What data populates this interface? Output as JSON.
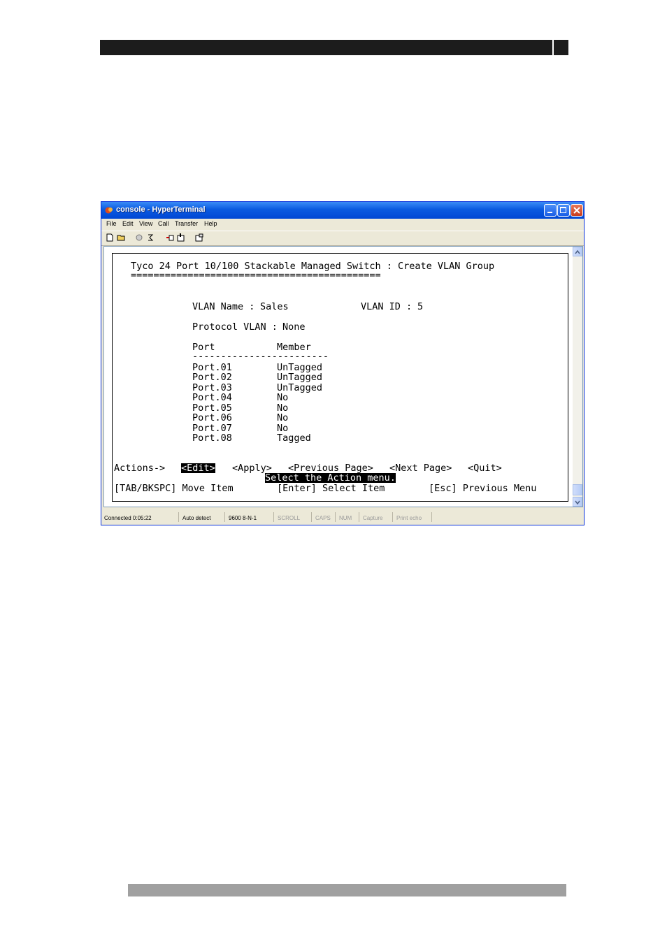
{
  "window": {
    "title": "console - HyperTerminal",
    "colors": {
      "titlebar": "#0a5ae0",
      "close": "#c73d1e"
    }
  },
  "menu": [
    "File",
    "Edit",
    "View",
    "Call",
    "Transfer",
    "Help"
  ],
  "toolbar_icons": [
    "new-icon",
    "open-icon",
    "disconnect-icon",
    "call-icon",
    "send-icon",
    "receive-icon",
    "properties-icon"
  ],
  "terminal": {
    "heading": "Tyco 24 Port 10/100 Stackable Managed Switch : Create VLAN Group",
    "underline": "============================================",
    "vlan_name_label": "VLAN Name :",
    "vlan_name": "Sales",
    "vlan_id_label": "VLAN ID :",
    "vlan_id": "5",
    "protocol_label": "Protocol VLAN :",
    "protocol": "None",
    "col_port": "Port",
    "col_member": "Member",
    "table_rule": "------------------------",
    "rows": [
      {
        "port": "Port.01",
        "member": "UnTagged"
      },
      {
        "port": "Port.02",
        "member": "UnTagged"
      },
      {
        "port": "Port.03",
        "member": "UnTagged"
      },
      {
        "port": "Port.04",
        "member": "No"
      },
      {
        "port": "Port.05",
        "member": "No"
      },
      {
        "port": "Port.06",
        "member": "No"
      },
      {
        "port": "Port.07",
        "member": "No"
      },
      {
        "port": "Port.08",
        "member": "Tagged"
      }
    ],
    "actions_label": "Actions->",
    "actions": {
      "edit": "<Edit>",
      "apply": "<Apply>",
      "prev": "<Previous Page>",
      "next": "<Next Page>",
      "quit": "<Quit>"
    },
    "message": "Select the Action menu.",
    "help_tab": "[TAB/BKSPC] Move Item",
    "help_enter": "[Enter] Select Item",
    "help_esc": "[Esc] Previous Menu"
  },
  "status": {
    "connected": "Connected 0:05:22",
    "detect": "Auto detect",
    "settings": "9600 8-N-1",
    "scroll": "SCROLL",
    "caps": "CAPS",
    "num": "NUM",
    "capture": "Capture",
    "print": "Print echo"
  }
}
